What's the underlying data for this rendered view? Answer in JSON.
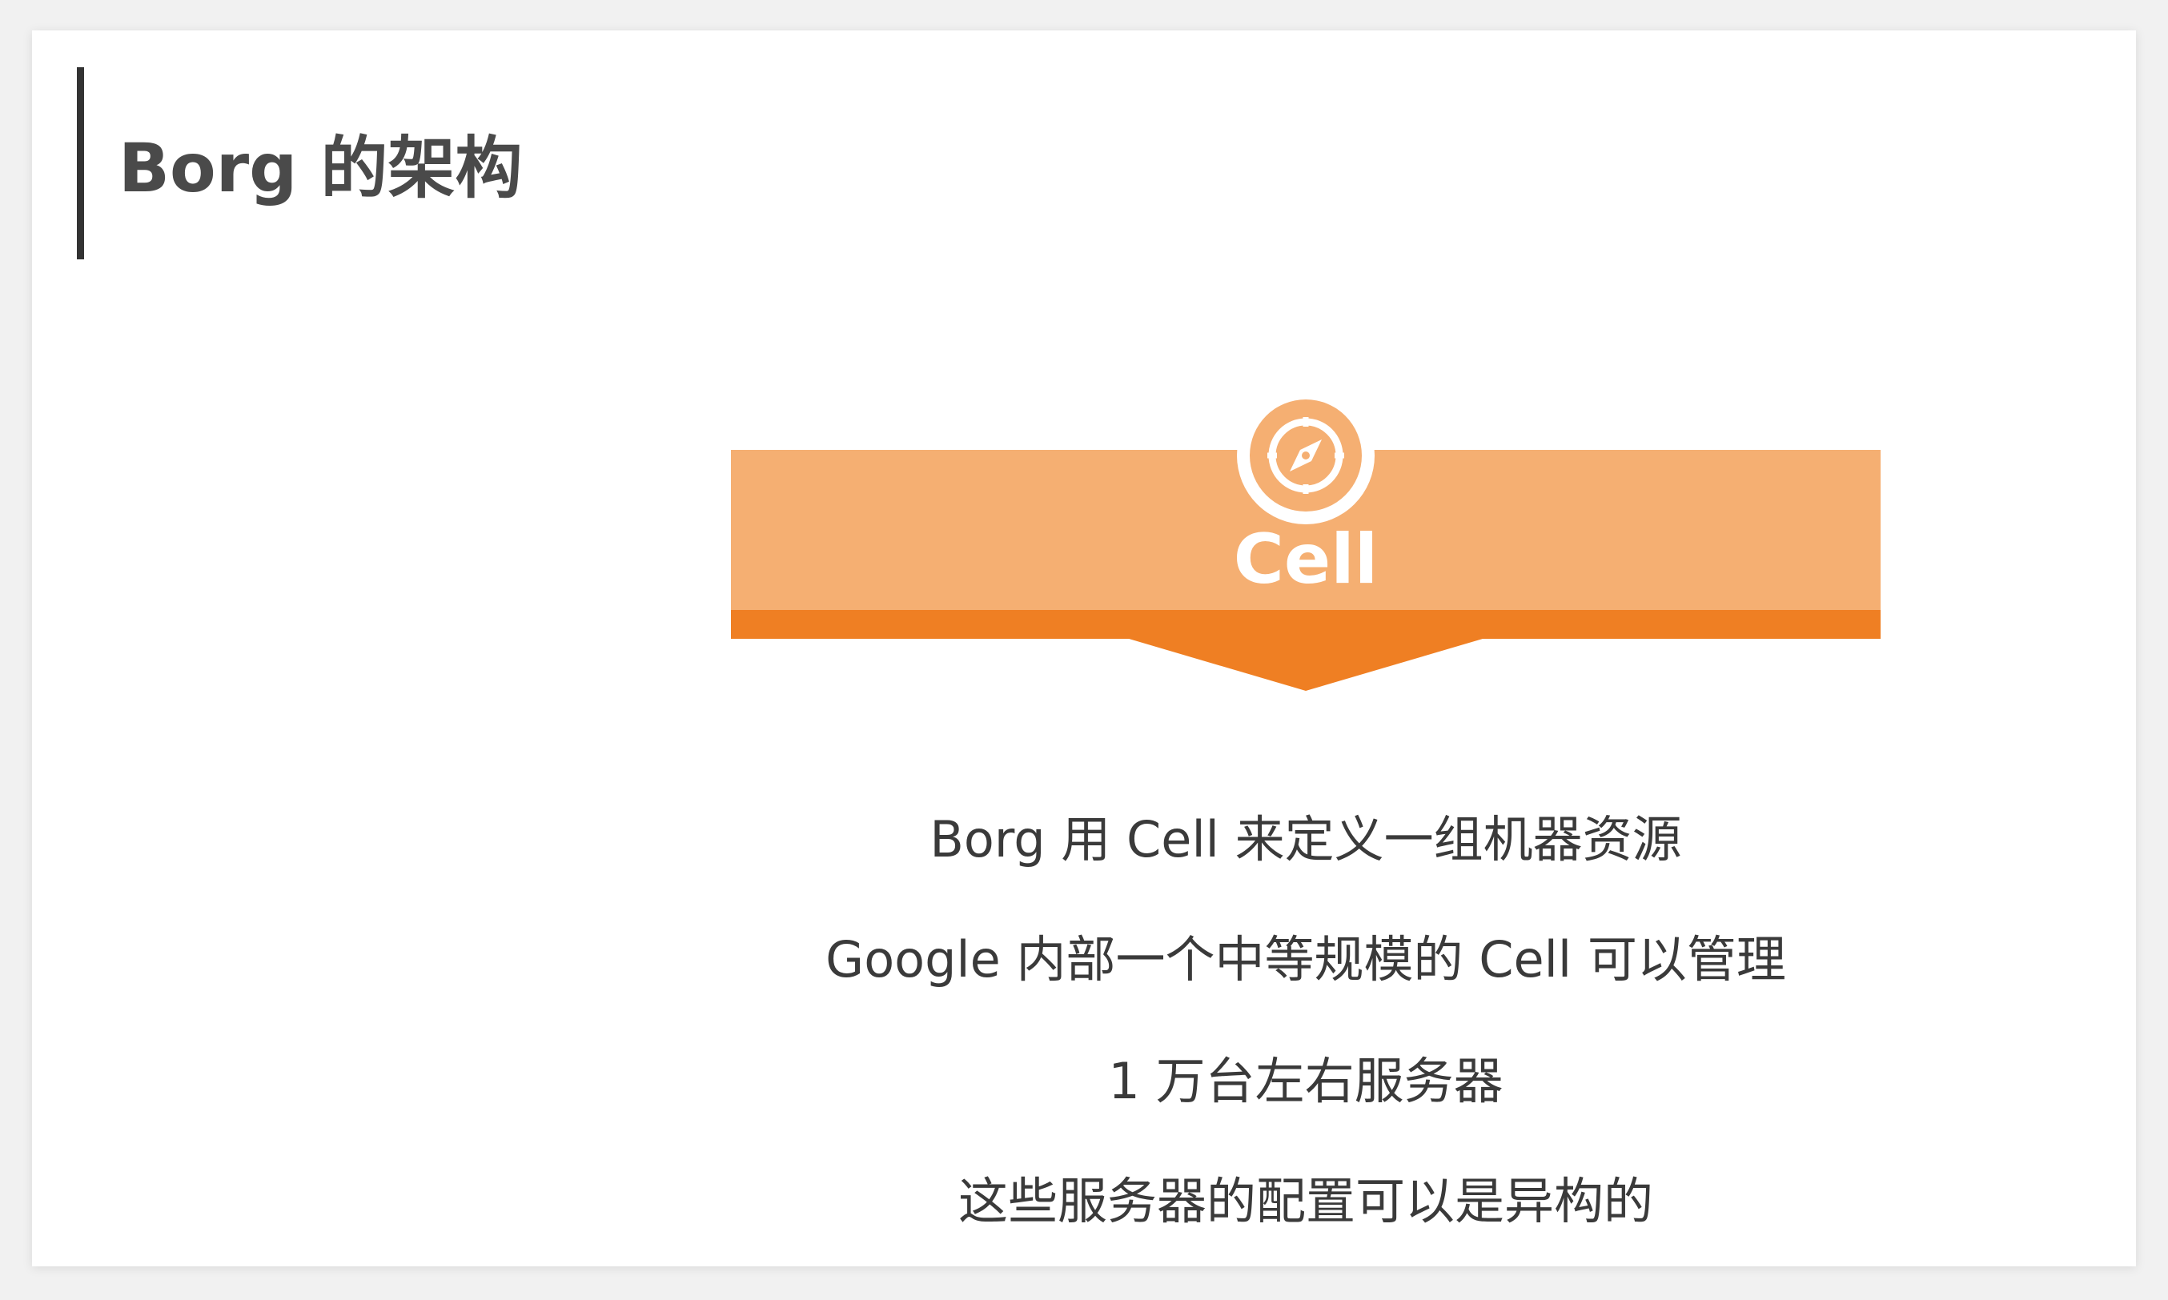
{
  "title": "Borg 的架构",
  "banner": {
    "label": "Cell",
    "icon": "compass-icon",
    "colors": {
      "light": "#f5af72",
      "dark": "#ef7f23"
    }
  },
  "lines": [
    "Borg 用 Cell 来定义一组机器资源",
    "Google 内部一个中等规模的 Cell 可以管理",
    "1 万台左右服务器",
    "这些服务器的配置可以是异构的"
  ]
}
